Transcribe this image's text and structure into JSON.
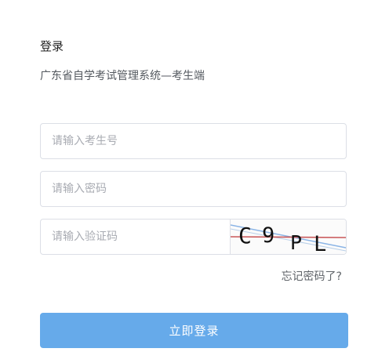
{
  "page": {
    "title": "登录",
    "subtitle": "广东省自学考试管理系统—考生端"
  },
  "form": {
    "candidate_id": {
      "value": "",
      "placeholder": "请输入考生号"
    },
    "password": {
      "value": "",
      "placeholder": "请输入密码"
    },
    "captcha_input": {
      "value": "",
      "placeholder": "请输入验证码"
    },
    "captcha_text": "C9PL"
  },
  "links": {
    "forgot_password": "忘记密码了?"
  },
  "actions": {
    "login_label": "立即登录"
  },
  "colors": {
    "primary": "#66aaea",
    "border": "#dcdfe6",
    "placeholder": "#a8abb2"
  }
}
